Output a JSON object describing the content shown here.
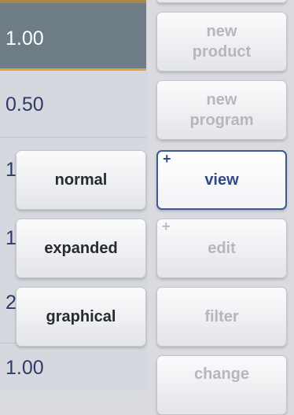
{
  "values": [
    "1.00",
    "0.50",
    "1",
    "1",
    "2",
    "1.00"
  ],
  "left_menu": {
    "normal": "normal",
    "expanded": "expanded",
    "graphical": "graphical"
  },
  "right_menu": {
    "new_product_line1": "new",
    "new_product_line2": "product",
    "new_program_line1": "new",
    "new_program_line2": "program",
    "view": "view",
    "edit": "edit",
    "filter": "filter",
    "change": "change",
    "plus": "+"
  },
  "colors": {
    "active_row": "#6e7c85",
    "accent": "#e6a23a",
    "selected_border": "#3d5894"
  }
}
